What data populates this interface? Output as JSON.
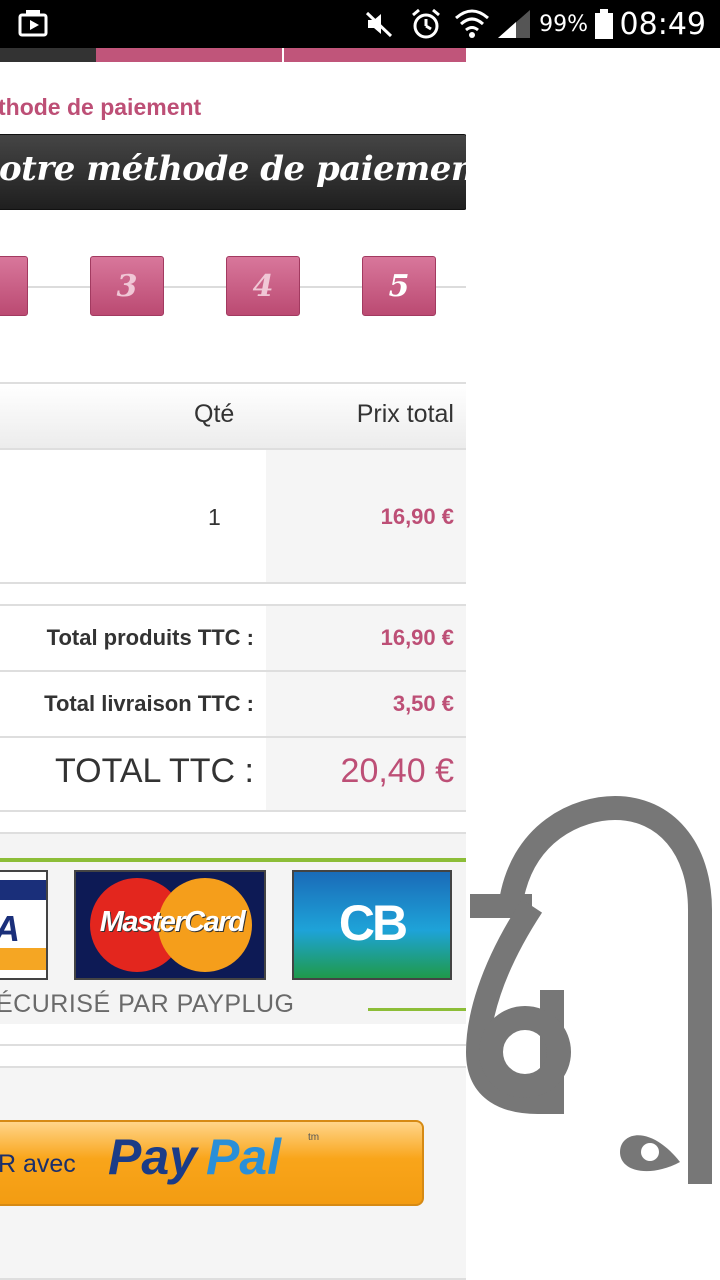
{
  "status_bar": {
    "battery_percent": "99%",
    "time": "08:49",
    "icons": [
      "media-player-icon",
      "mute-icon",
      "alarm-icon",
      "wifi-icon",
      "signal-icon",
      "battery-icon"
    ]
  },
  "breadcrumb": "thode de paiement",
  "page_title": "otre méthode de paiement",
  "steps": [
    "3",
    "4",
    "5"
  ],
  "cart": {
    "headers": {
      "qty": "Qté",
      "total": "Prix total"
    },
    "rows": [
      {
        "qty": "1",
        "total": "16,90 €"
      }
    ]
  },
  "totals": {
    "products_label": "Total produits TTC :",
    "products_value": "16,90 €",
    "shipping_label": "Total livraison TTC :",
    "shipping_value": "3,50 €",
    "grand_label": "TOTAL TTC :",
    "grand_value": "20,40 €"
  },
  "payplug": {
    "cards": [
      "visa",
      "MasterCard",
      "CB"
    ],
    "mastercard_label": "MasterCard",
    "cb_label": "CB",
    "secure_text": "ÉCURISÉ PAR PAYPLUG"
  },
  "paypal": {
    "prefix_text": "R avec",
    "logo_pay": "Pay",
    "logo_pal": "Pal",
    "tm": "tm"
  },
  "colors": {
    "accent_pink": "#bd4f76",
    "title_bg": "#2a2a2a",
    "paypal_orange": "#f9a51a",
    "payplug_green": "#8cbd37"
  }
}
